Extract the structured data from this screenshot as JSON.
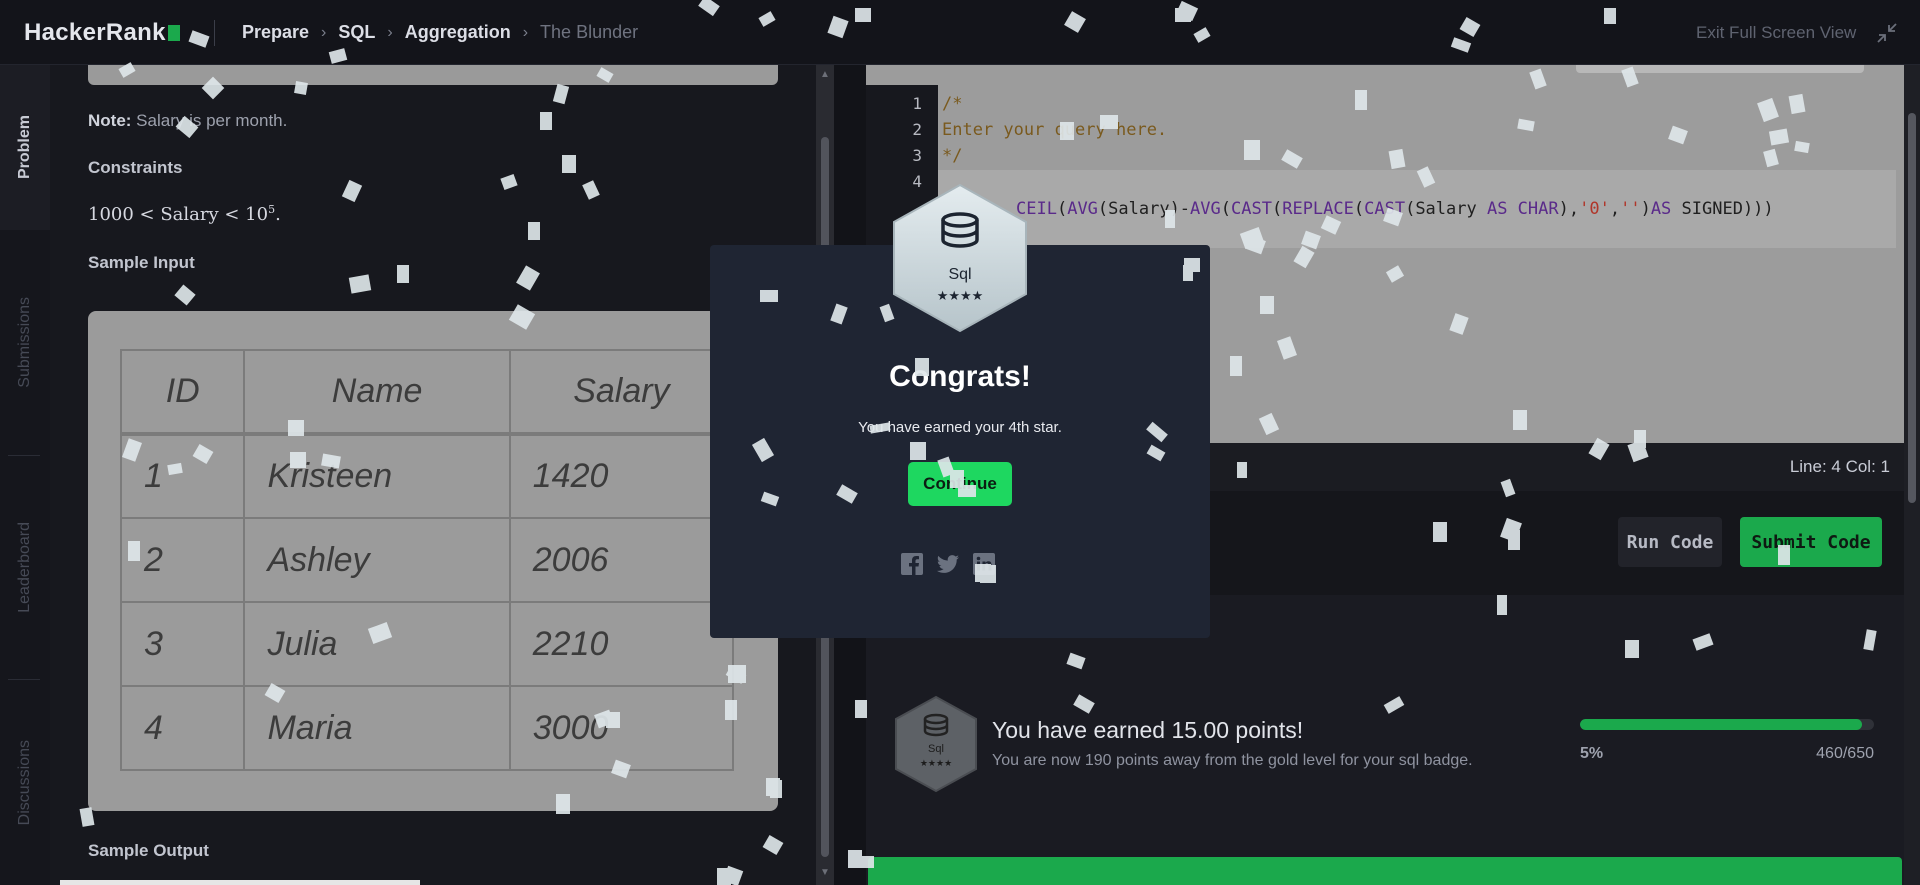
{
  "header": {
    "logo": "HackerRank",
    "breadcrumb": [
      "Prepare",
      "SQL",
      "Aggregation"
    ],
    "current_page": "The Blunder",
    "exit_fullscreen": "Exit Full Screen View"
  },
  "sidetabs": [
    "Problem",
    "Submissions",
    "Leaderboard",
    "Discussions"
  ],
  "problem": {
    "note_label": "Note:",
    "note_text": " Salary is per month.",
    "constraints_heading": "Constraints",
    "constraint_lhs": "1000 < Salary < 10",
    "constraint_exp": "5",
    "constraint_tail": ".",
    "sample_input_heading": "Sample Input",
    "sample_output_heading": "Sample Output",
    "table": {
      "headers": [
        "ID",
        "Name",
        "Salary"
      ],
      "rows": [
        [
          "1",
          "Kristeen",
          "1420"
        ],
        [
          "2",
          "Ashley",
          "2006"
        ],
        [
          "3",
          "Julia",
          "2210"
        ],
        [
          "4",
          "Maria",
          "3000"
        ]
      ]
    }
  },
  "editor": {
    "line_numbers": [
      "1",
      "2",
      "3",
      "4"
    ],
    "comment_lines": [
      "/*",
      "Enter your query here.",
      "*/"
    ],
    "code_line": {
      "t1": "CEIL",
      "t2": "(",
      "t3": "AVG",
      "t4": "(Salary)-",
      "t5": "AVG",
      "t6": "(",
      "t7": "CAST",
      "t8": "(",
      "t9": "REPLACE",
      "t10": "(",
      "t11": "CAST",
      "t12": "(Salary ",
      "t13": "AS CHAR",
      "t14": "),",
      "t15": "'0'",
      "t16": ",",
      "t17": "''",
      "t18": ")",
      "t19": "AS",
      "t20": " SIGNED)))"
    },
    "status": "Line: 4 Col: 1",
    "run_label": "Run Code",
    "submit_label": "Submit Code"
  },
  "result": {
    "badge_name": "Sql",
    "points_title": "You have earned 15.00 points!",
    "points_sub": "You are now 190 points away from the gold level for your sql badge.",
    "progress_fraction": 0.05,
    "progress_pct": "5%",
    "progress_count": "460/650"
  },
  "modal": {
    "badge_name": "Sql",
    "title": "Congrats!",
    "subtitle": "You have earned your 4th star.",
    "continue_label": "Continue",
    "share_icons": [
      "facebook-icon",
      "twitter-icon",
      "linkedin-icon"
    ]
  },
  "colors": {
    "brand_green": "#1ba94c",
    "modal_bg": "#1f2533",
    "continue_green": "#1ed760"
  }
}
